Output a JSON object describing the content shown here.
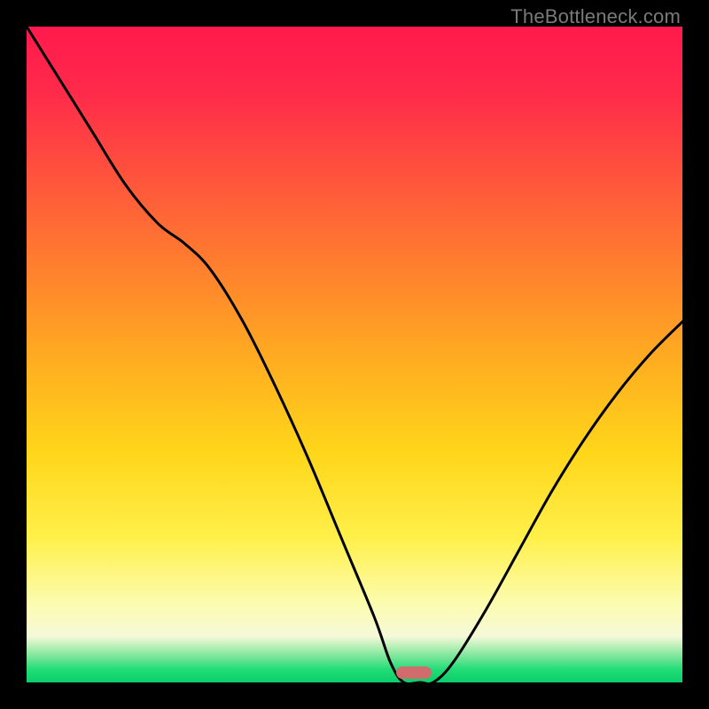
{
  "watermark": "TheBottleneck.com",
  "chart_data": {
    "type": "line",
    "title": "",
    "xlabel": "",
    "ylabel": "",
    "xlim": [
      0,
      1
    ],
    "ylim": [
      0,
      1
    ],
    "grid": false,
    "legend": false,
    "annotation_marker": {
      "x": 0.59,
      "y": 0.0,
      "color": "#d06c6c",
      "shape": "pill"
    },
    "background_gradient_stops": [
      {
        "pos": 0.0,
        "color": "#ff1a4d"
      },
      {
        "pos": 0.25,
        "color": "#ff5a3a"
      },
      {
        "pos": 0.52,
        "color": "#ffb020"
      },
      {
        "pos": 0.78,
        "color": "#fff04a"
      },
      {
        "pos": 0.93,
        "color": "#f5f9d8"
      },
      {
        "pos": 1.0,
        "color": "#0bce6b"
      }
    ],
    "series": [
      {
        "name": "bottleneck-curve",
        "x": [
          0.0,
          0.05,
          0.1,
          0.15,
          0.2,
          0.24,
          0.28,
          0.33,
          0.38,
          0.43,
          0.48,
          0.53,
          0.555,
          0.575,
          0.6,
          0.62,
          0.65,
          0.7,
          0.75,
          0.8,
          0.85,
          0.9,
          0.95,
          1.0
        ],
        "y": [
          1.0,
          0.92,
          0.84,
          0.76,
          0.7,
          0.67,
          0.63,
          0.55,
          0.45,
          0.34,
          0.22,
          0.1,
          0.03,
          0.0,
          0.0,
          0.0,
          0.03,
          0.11,
          0.2,
          0.29,
          0.37,
          0.44,
          0.5,
          0.55
        ]
      }
    ]
  }
}
